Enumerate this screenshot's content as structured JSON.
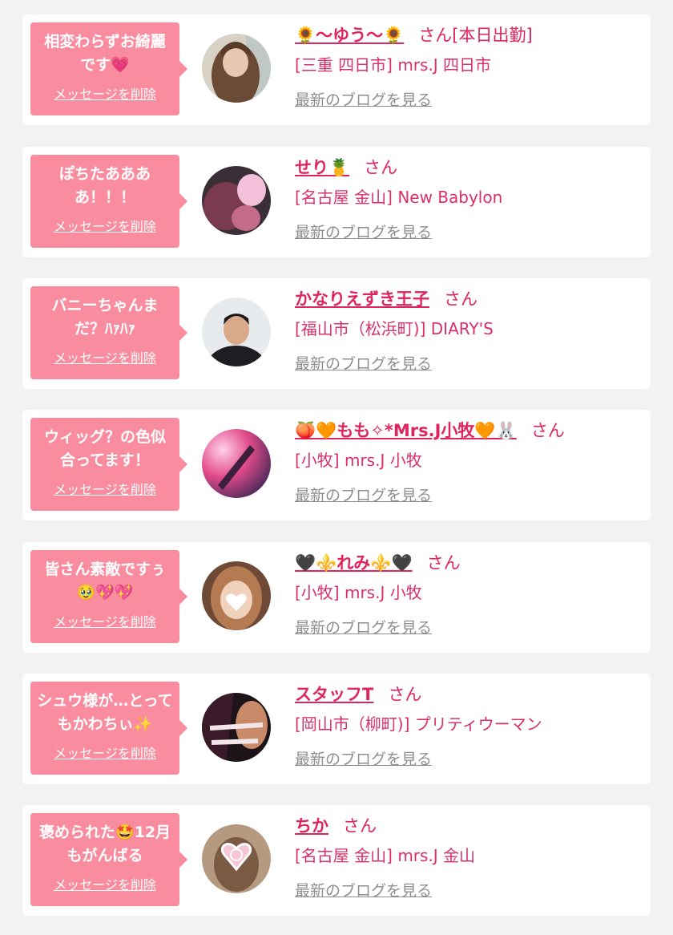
{
  "delete_label": "メッセージを削除",
  "blog_label": "最新のブログを見る",
  "suffix": "さん",
  "accent": "#e0245e",
  "bubble_color": "#f98c9f",
  "cards": [
    {
      "message": "相変わらずお綺麗です💗",
      "name": "🌻〜ゆう〜🌻",
      "suffix": "さん[本日出勤]",
      "shop": "[三重 四日市] mrs.J 四日市"
    },
    {
      "message": "ぽちたああああ！！！",
      "name": "せり🍍",
      "suffix": "さん",
      "shop": "[名古屋 金山] New Babylon"
    },
    {
      "message": "バニーちゃんまだ？ﾊｧﾊｧ",
      "name": "かなりえずき王子",
      "suffix": "さん",
      "shop": "[福山市（松浜町)] DIARY'S"
    },
    {
      "message": "ウィッグ？の色似合ってます！",
      "name": "🍑🧡もも✧*Mrs.J小牧🧡🐰",
      "suffix": "さん",
      "shop": "[小牧] mrs.J 小牧"
    },
    {
      "message": "皆さん素敵ですぅ🥹💖💖",
      "name": "🖤⚜️れみ⚜️🖤",
      "suffix": "さん",
      "shop": "[小牧] mrs.J 小牧"
    },
    {
      "message": "シュウ様が…とってもかわちぃ✨",
      "name": "スタッフT",
      "suffix": "さん",
      "shop": "[岡山市（柳町)] プリティウーマン"
    },
    {
      "message": "褒められた🤩12月もがんばる",
      "name": "ちか",
      "suffix": "さん",
      "shop": "[名古屋 金山] mrs.J 金山"
    }
  ]
}
